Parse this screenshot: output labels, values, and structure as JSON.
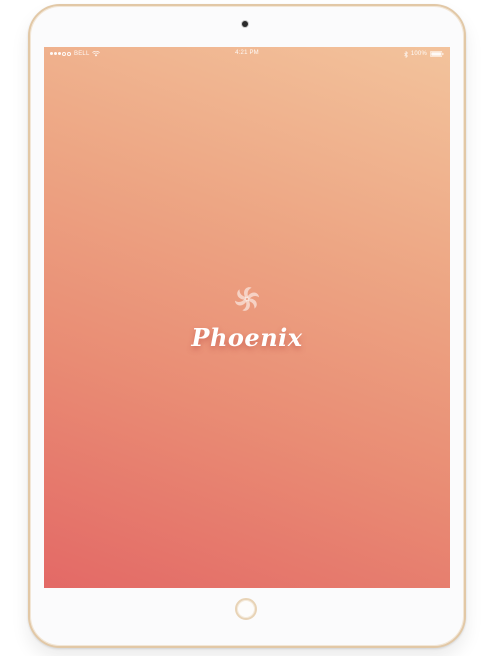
{
  "status_bar": {
    "carrier": "BELL",
    "time": "4:21 PM",
    "battery": "100%",
    "signal_icon": "signal-dots-icon",
    "wifi_icon": "wifi-icon",
    "bluetooth_icon": "bluetooth-icon",
    "battery_icon": "battery-icon"
  },
  "splash": {
    "app_name": "Phoenix",
    "logo_icon": "pinwheel-logo-icon"
  },
  "colors": {
    "gradient_top": "#f3c39c",
    "gradient_bottom": "#e36966",
    "device_frame": "#e2c8a6",
    "text": "#ffffff"
  }
}
